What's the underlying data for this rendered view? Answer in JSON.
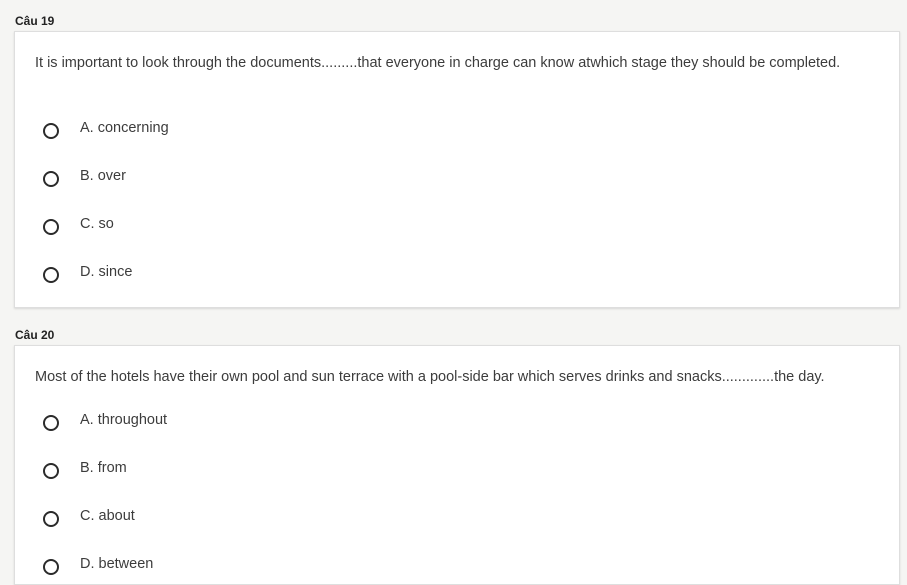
{
  "questions": [
    {
      "heading": "Câu 19",
      "text": "It is important to look through the documents.........that everyone in charge can know atwhich stage they should be completed.",
      "options": [
        "A. concerning",
        "B. over",
        "C. so",
        "D. since"
      ]
    },
    {
      "heading": "Câu 20",
      "text": "Most of the hotels have their own pool and sun terrace with a pool-side bar which serves drinks and snacks.............the day.",
      "options": [
        "A. throughout",
        "B. from",
        "C. about",
        "D. between"
      ]
    }
  ]
}
